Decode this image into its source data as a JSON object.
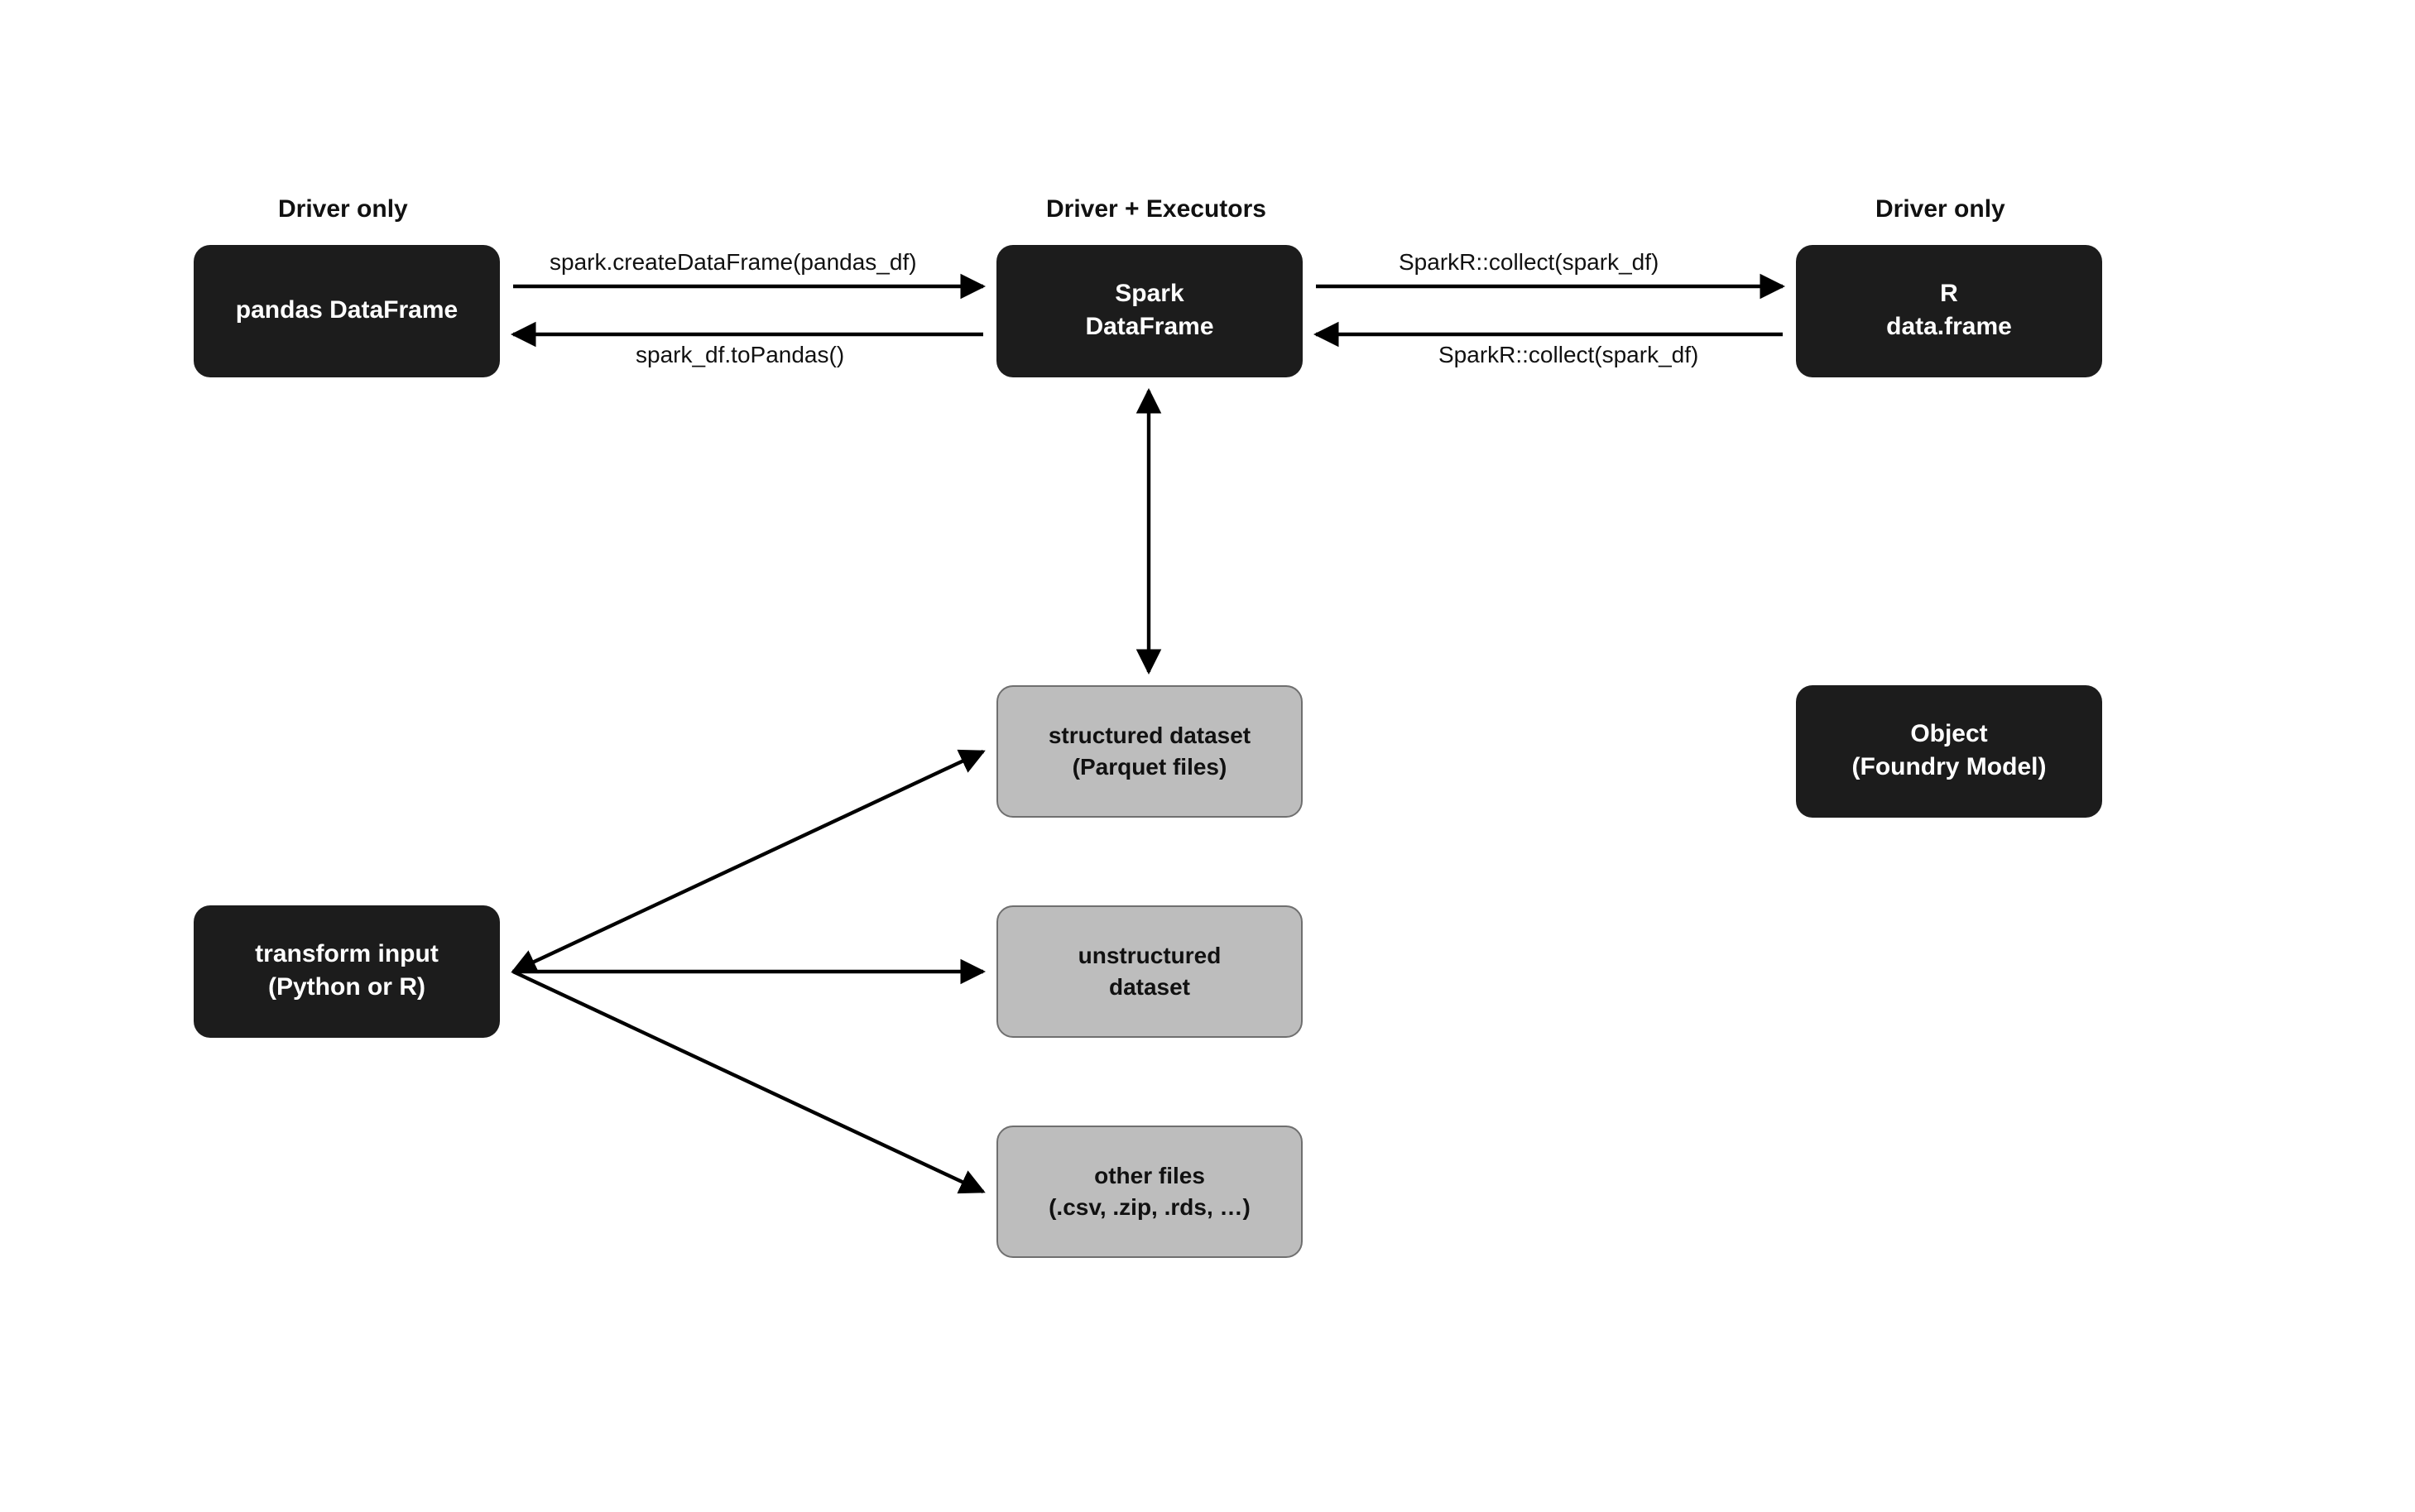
{
  "headers": {
    "left": "Driver only",
    "center": "Driver + Executors",
    "right": "Driver only"
  },
  "nodes": {
    "pandas_df": {
      "line1": "pandas DataFrame"
    },
    "spark_df": {
      "line1": "Spark",
      "line2": "DataFrame"
    },
    "r_df": {
      "line1": "R",
      "line2": "data.frame"
    },
    "structured": {
      "line1": "structured dataset",
      "line2": "(Parquet files)"
    },
    "unstructured": {
      "line1": "unstructured",
      "line2": "dataset"
    },
    "other": {
      "line1": "other files",
      "line2": "(.csv, .zip, .rds, …)"
    },
    "transform": {
      "line1": "transform input",
      "line2": "(Python or R)"
    },
    "object": {
      "line1": "Object",
      "line2": "(Foundry Model)"
    }
  },
  "edges": {
    "pandas_to_spark": "spark.createDataFrame(pandas_df)",
    "spark_to_pandas": "spark_df.toPandas()",
    "spark_to_r": "SparkR::collect(spark_df)",
    "r_to_spark": "SparkR::collect(spark_df)"
  }
}
